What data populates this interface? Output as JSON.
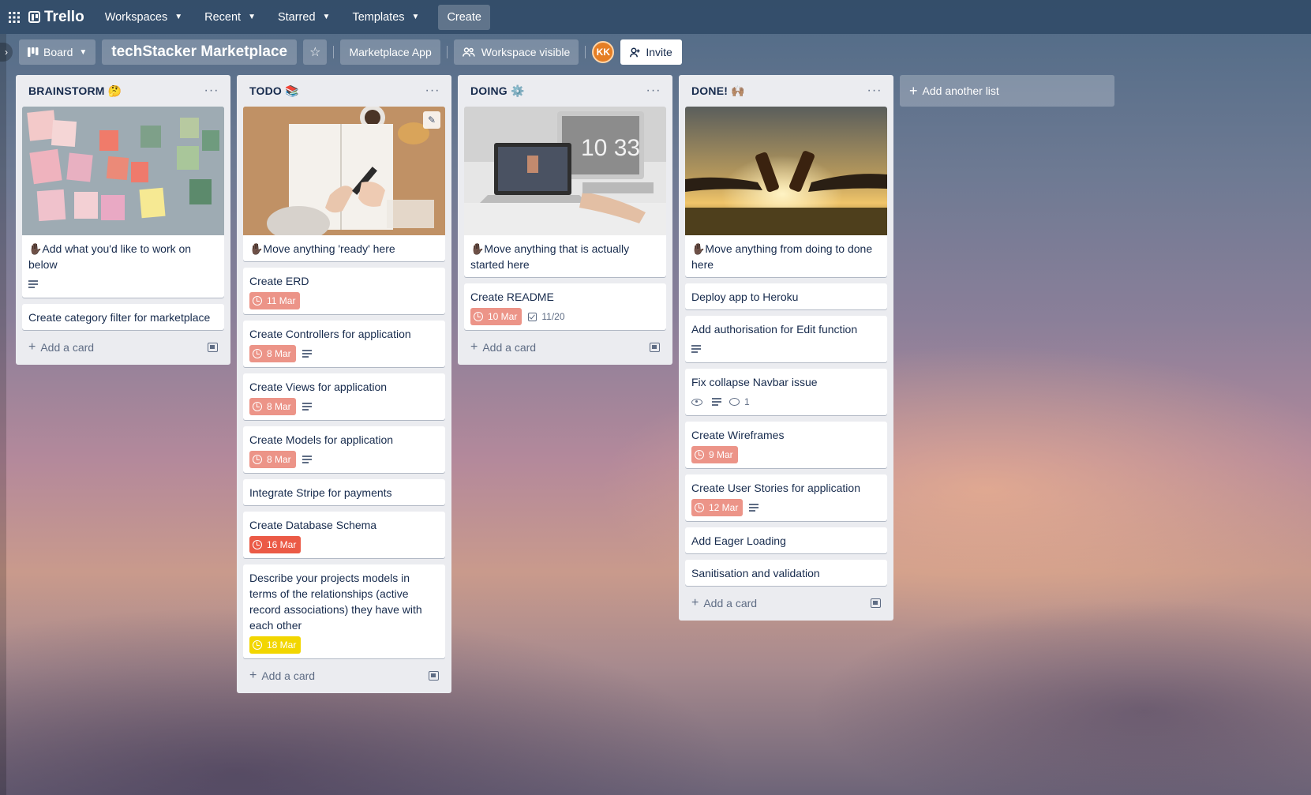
{
  "nav": {
    "workspaces": "Workspaces",
    "recent": "Recent",
    "starred": "Starred",
    "templates": "Templates",
    "create": "Create",
    "logo": "Trello"
  },
  "board": {
    "view": "Board",
    "title": "techStacker Marketplace",
    "tag": "Marketplace App",
    "visibility": "Workspace visible",
    "avatar_initials": "KK",
    "invite": "Invite"
  },
  "lists": {
    "brainstorm": {
      "title": "BRAINSTORM 🤔",
      "cards": [
        {
          "title": "✋🏿Add what you'd like to work on below"
        },
        {
          "title": "Create category filter for marketplace"
        }
      ],
      "add_card": "Add a card"
    },
    "todo": {
      "title": "TODO 📚",
      "cards": [
        {
          "title": "✋🏿Move anything 'ready' here"
        },
        {
          "title": "Create ERD",
          "date": "11 Mar"
        },
        {
          "title": "Create Controllers for application",
          "date": "8 Mar"
        },
        {
          "title": "Create Views for application",
          "date": "8 Mar"
        },
        {
          "title": "Create Models for application",
          "date": "8 Mar"
        },
        {
          "title": "Integrate Stripe for payments"
        },
        {
          "title": "Create Database Schema",
          "date": "16 Mar"
        },
        {
          "title": "Describe your projects models in terms of the relationships (active record associations) they have with each other",
          "date": "18 Mar"
        }
      ],
      "add_card": "Add a card"
    },
    "doing": {
      "title": "DOING ⚙️",
      "cards": [
        {
          "title": "✋🏿Move anything that is actually started here"
        },
        {
          "title": "Create README",
          "date": "10 Mar",
          "checklist": "11/20"
        }
      ],
      "add_card": "Add a card"
    },
    "done": {
      "title": "DONE! 🙌🏽",
      "cards": [
        {
          "title": "✋🏿Move anything from doing to done here"
        },
        {
          "title": "Deploy app to Heroku"
        },
        {
          "title": "Add authorisation for Edit function"
        },
        {
          "title": "Fix collapse Navbar issue",
          "comments": "1"
        },
        {
          "title": "Create Wireframes",
          "date": "9 Mar"
        },
        {
          "title": "Create User Stories for application",
          "date": "12 Mar"
        },
        {
          "title": "Add Eager Loading"
        },
        {
          "title": "Sanitisation and validation"
        }
      ],
      "add_card": "Add a card"
    }
  },
  "add_list": "Add another list",
  "colors": {
    "nav_bg": "#324c68",
    "list_bg": "#ebecf0",
    "due_soon": "#ec9488",
    "overdue": "#eb5a46",
    "due_yellow": "#f2d600",
    "avatar": "#e57e25"
  },
  "icons": [
    "apps-grid-icon",
    "trello-logo-icon",
    "chevron-down-icon",
    "board-icon",
    "star-icon",
    "people-icon",
    "person-add-icon",
    "more-icon",
    "clock-icon",
    "description-icon",
    "checklist-icon",
    "eye-icon",
    "comment-icon",
    "plus-icon",
    "template-icon",
    "pencil-icon"
  ]
}
